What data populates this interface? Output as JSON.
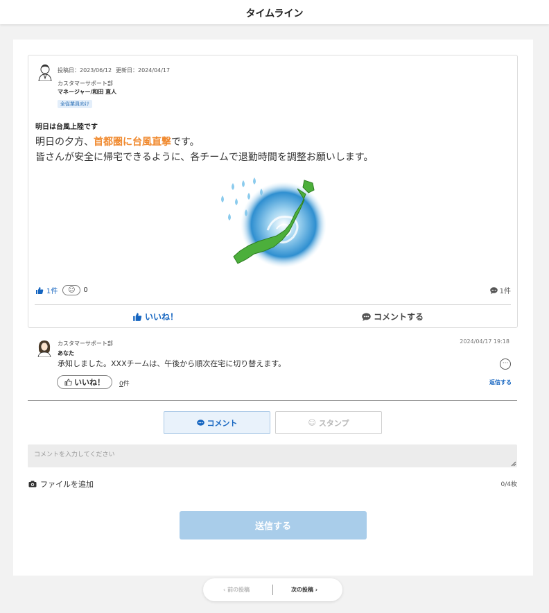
{
  "header": {
    "title": "タイムライン"
  },
  "post": {
    "posted_date": "投稿日：2023/06/12",
    "updated_date": "更新日：2024/04/17",
    "department": "カスタマーサポート部",
    "author": "マネージャー/和田 直人",
    "tag": "全従業員向け",
    "title": "明日は台風上陸です",
    "body_line1_pre": "明日の夕方、",
    "body_line1_highlight": "首都圏に台風直撃",
    "body_line1_post": "です。",
    "body_line2": "皆さんが安全に帰宅できるように、各チームで退勤時間を調整お願いします。",
    "like_count": "1件",
    "emoji_count": "0",
    "comment_count": "1件",
    "like_action": "いいね！",
    "comment_action": "コメントする"
  },
  "reply": {
    "department": "カスタマーサポート部",
    "author": "あなた",
    "date": "2024/04/17 19:18",
    "text": "承知しました。XXXチームは、午後から順次在宅に切り替えます。",
    "like_label": "いいね！",
    "like_count_num": "0",
    "like_count_unit": "件",
    "reply_link": "返信する"
  },
  "composer": {
    "tab_comment": "コメント",
    "tab_stamp": "スタンプ",
    "placeholder": "コメントを入力してください",
    "file_add": "ファイルを追加",
    "file_count": "0/4枚",
    "send_label": "送信する"
  },
  "pager": {
    "prev_label": "前の投稿",
    "next_label": "次の投稿"
  },
  "colors": {
    "accent_blue": "#1565c0",
    "highlight_orange": "#f0892e",
    "send_button": "#a9cdea"
  }
}
